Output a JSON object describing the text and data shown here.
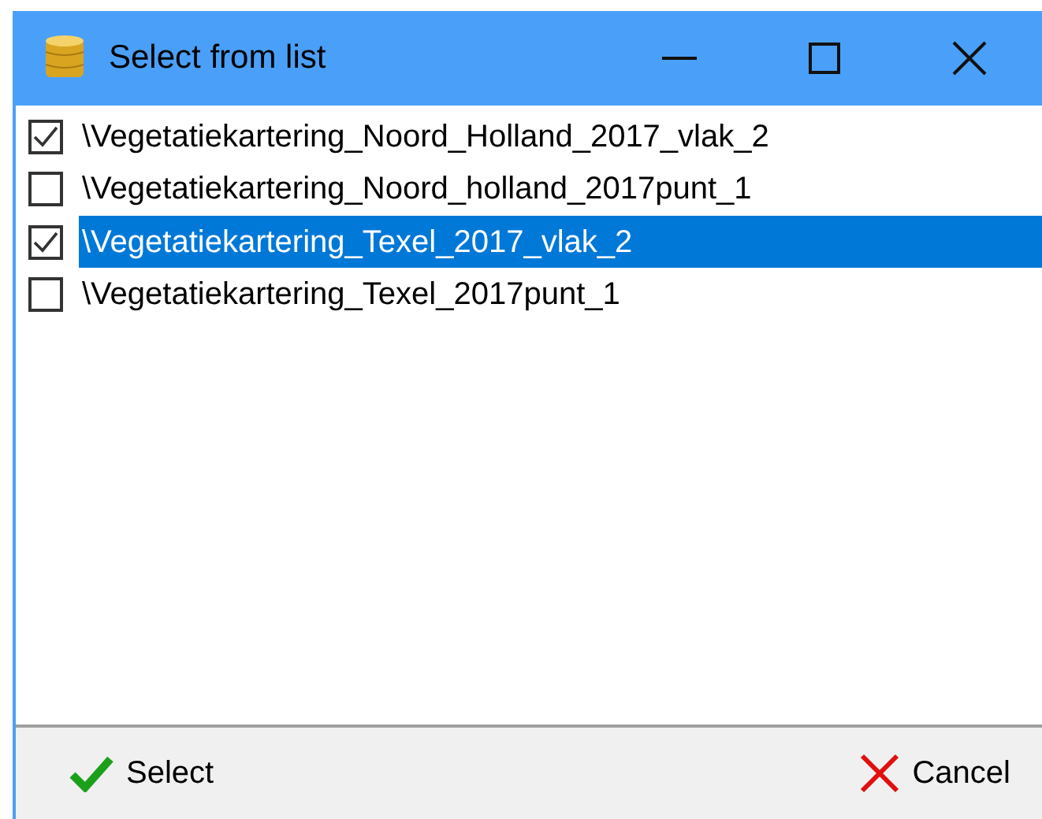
{
  "window": {
    "title": "Select from list"
  },
  "items": [
    {
      "label": "\\Vegetatiekartering_Noord_Holland_2017_vlak_2",
      "checked": true,
      "selected": false
    },
    {
      "label": "\\Vegetatiekartering_Noord_holland_2017punt_1",
      "checked": false,
      "selected": false
    },
    {
      "label": "\\Vegetatiekartering_Texel_2017_vlak_2",
      "checked": true,
      "selected": true
    },
    {
      "label": "\\Vegetatiekartering_Texel_2017punt_1",
      "checked": false,
      "selected": false
    }
  ],
  "buttons": [
    {
      "kind": "ok",
      "label": "Select"
    },
    {
      "kind": "cancel",
      "label": "Cancel"
    }
  ]
}
